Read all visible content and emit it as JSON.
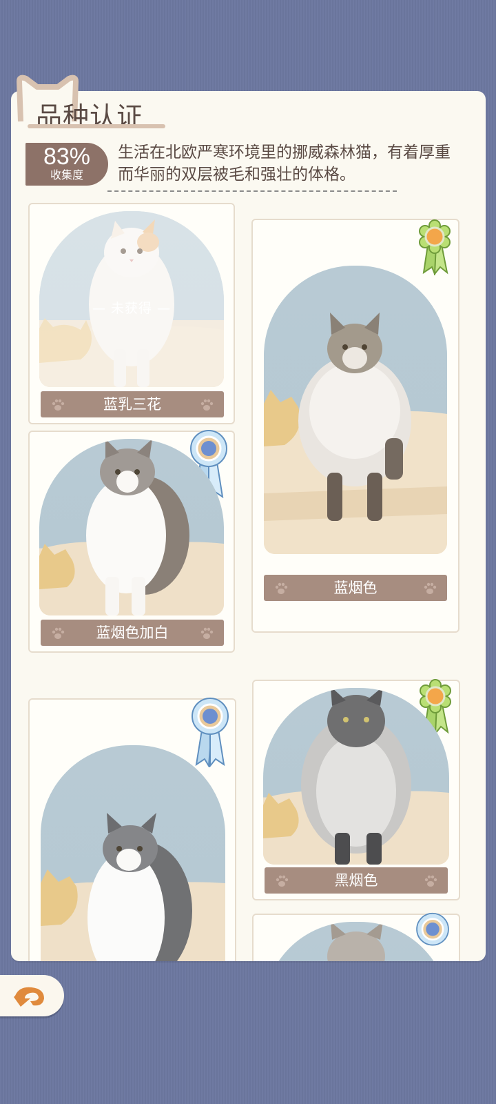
{
  "header": {
    "title": "品种认证"
  },
  "collection": {
    "percent": "83%",
    "label": "收集度"
  },
  "breed": {
    "description": "生活在北欧严寒环境里的挪威森林猫，有着厚重而华丽的双层被毛和强壮的体格。"
  },
  "variants": [
    {
      "name": "蓝乳三花",
      "status": "— 未获得 —",
      "obtained": false,
      "badge": "none"
    },
    {
      "name": "蓝烟色",
      "obtained": true,
      "badge": "green-rosette-icon"
    },
    {
      "name": "蓝烟色加白",
      "obtained": true,
      "badge": "blue-rosette-icon"
    },
    {
      "name": "黑烟色",
      "obtained": true,
      "badge": "green-rosette-icon"
    }
  ],
  "colors": {
    "background": "#6f7aa2",
    "panel": "#fbf9f1",
    "nameplate": "#a78d80",
    "badge": "#8d7268",
    "back_icon": "#e08a3c"
  },
  "nav": {
    "back_icon": "back-arrow-icon"
  }
}
